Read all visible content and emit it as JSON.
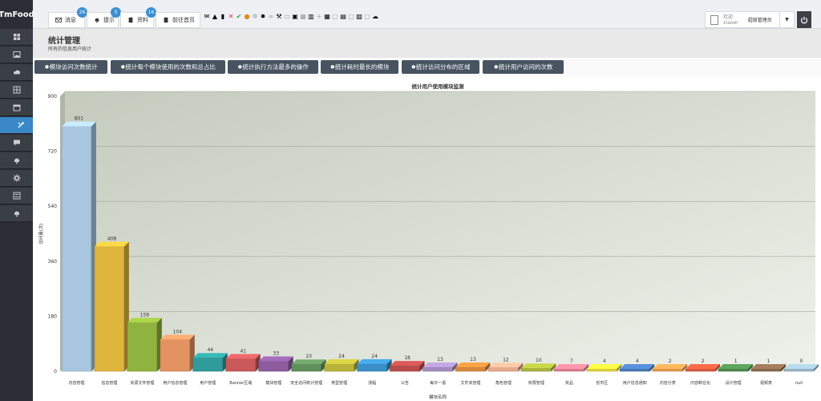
{
  "app": {
    "logo": "TmFood"
  },
  "sidebar": {
    "items": [
      {
        "name": "dashboard-icon"
      },
      {
        "name": "image-icon"
      },
      {
        "name": "cloud-icon"
      },
      {
        "name": "grid-icon"
      },
      {
        "name": "calendar-icon"
      },
      {
        "name": "tools-icon",
        "active": true
      },
      {
        "name": "comment-icon"
      },
      {
        "name": "bell-icon"
      },
      {
        "name": "gear-icon"
      },
      {
        "name": "list-icon"
      },
      {
        "name": "bell-icon"
      }
    ]
  },
  "topbar": {
    "tabs": [
      {
        "label": "消息",
        "badge": "26",
        "icon": "mail-icon"
      },
      {
        "label": "提示",
        "badge": "5",
        "icon": "bell-icon"
      },
      {
        "label": "资料",
        "badge": "16",
        "icon": "document-icon"
      },
      {
        "label": "前往首页",
        "badge": "",
        "icon": "document-icon"
      }
    ],
    "user": {
      "welcome": "欢迎",
      "username": "xiaoer",
      "role": "超级管理员"
    }
  },
  "page": {
    "title": "统计管理",
    "subtitle": "所有的信息用户统计"
  },
  "buttons": [
    "模块访问次数统计",
    "统计每个模块使用的次数和总占比",
    "统计执行方法最多的操作",
    "统计耗时最长的模块",
    "统计访问分布的区域",
    "统计用户访问的次数"
  ],
  "chart_data": {
    "type": "bar",
    "title": "统计用户使用模块监测",
    "xlabel": "模块名称",
    "ylabel": "访问量(次)",
    "ylim": [
      0,
      900
    ],
    "yticks": [
      0,
      180,
      360,
      540,
      720,
      900
    ],
    "categories": [
      "内容管理",
      "信息管理",
      "资源文件管理",
      "用户信息管理",
      "用户管理",
      "Banner区域",
      "模块管理",
      "安全访问统计管理",
      "类型管理",
      "涨幅",
      "公告",
      "每日一语",
      "文件夹管理",
      "角色管理",
      "权限管理",
      "奖品",
      "省市区",
      "用户信息通知",
      "内容分类",
      "内容断在化",
      "设计管理",
      "视频表",
      "null"
    ],
    "values": [
      801,
      408,
      159,
      104,
      44,
      41,
      33,
      23,
      24,
      24,
      18,
      13,
      13,
      12,
      10,
      7,
      4,
      4,
      2,
      2,
      1,
      1,
      0
    ],
    "colors": [
      "#a8c6e0",
      "#e0b53c",
      "#8fb33e",
      "#e39361",
      "#2f9b9a",
      "#c9585b",
      "#8c5c9e",
      "#5f8f5c",
      "#b8b23a",
      "#3b8fc8",
      "#b94b4b",
      "#a58cc0",
      "#d9883d",
      "#e8a98c",
      "#a9b43c",
      "#e07f8f",
      "#e6d43a",
      "#4a7ab8",
      "#e89a4e",
      "#d95a3e",
      "#4f8a4e",
      "#8a6a4e",
      "#9ab8c8"
    ]
  }
}
